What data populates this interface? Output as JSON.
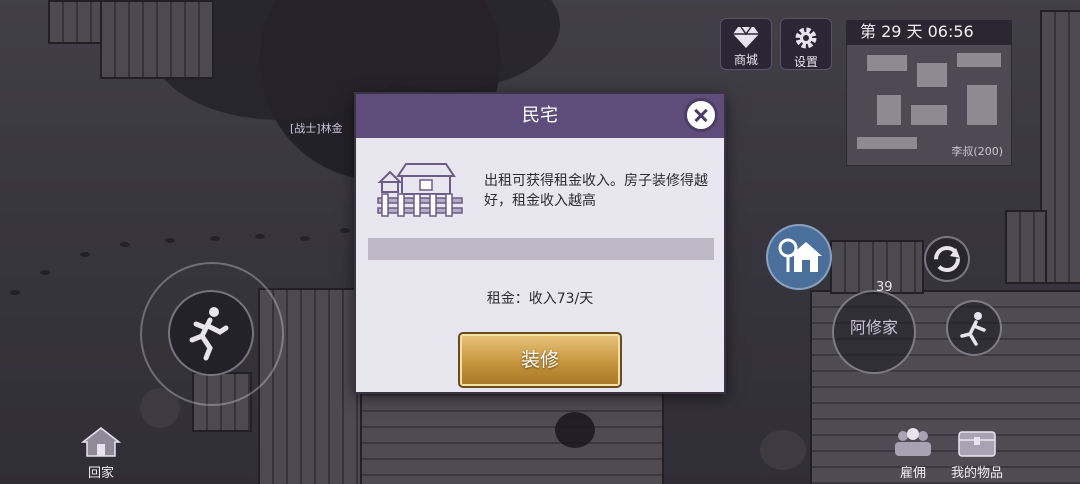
{
  "hud": {
    "shop_label": "商城",
    "settings_label": "设置",
    "day_time": "第 29 天   06:56",
    "minimap_label": "李叔(200)",
    "home_label": "回家",
    "hire_label": "雇佣",
    "items_label": "我的物品",
    "player_tag": "[战士]林金",
    "enemy_level": "39",
    "target_name": "阿修家"
  },
  "dialog": {
    "title": "民宅",
    "description": "出租可获得租金收入。房子装修得越好，租金收入越高",
    "progress": 0,
    "rent_text": "租金：收入73/天",
    "upgrade_label": "装修"
  },
  "colors": {
    "header": "#5e4c7a",
    "button_gold": "#c6963d",
    "panel": "#e8e6ee"
  },
  "icons": [
    "diamond-icon",
    "gear-icon",
    "house-icon",
    "run-icon",
    "close-icon",
    "refresh-icon",
    "home-key-icon",
    "crowd-icon",
    "chest-icon"
  ]
}
